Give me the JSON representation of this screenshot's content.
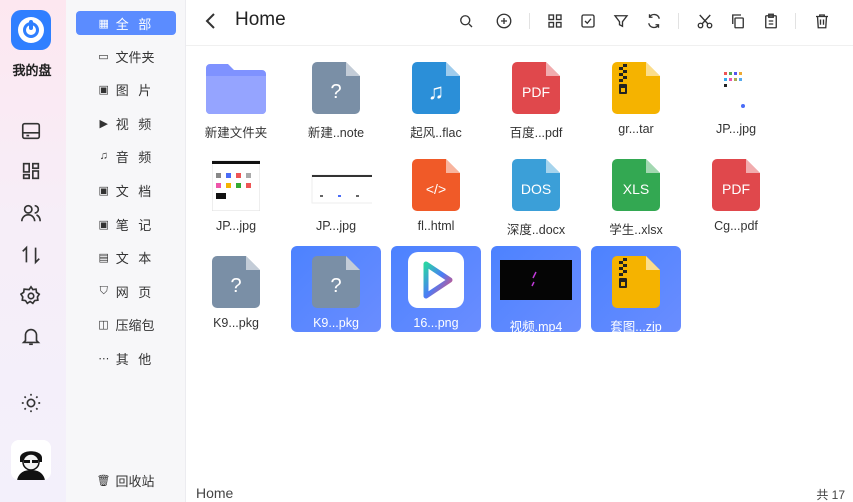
{
  "app": {
    "brand": "我的盘"
  },
  "sidebar": {
    "items": [
      {
        "label": "全 部",
        "icon": "grid-icon",
        "active": true
      },
      {
        "label": "文件夹",
        "icon": "folder-icon"
      },
      {
        "label": "图 片",
        "icon": "image-icon"
      },
      {
        "label": "视 频",
        "icon": "video-icon"
      },
      {
        "label": "音 频",
        "icon": "music-icon"
      },
      {
        "label": "文 档",
        "icon": "document-image-icon"
      },
      {
        "label": "笔 记",
        "icon": "note-icon"
      },
      {
        "label": "文 本",
        "icon": "text-file-icon"
      },
      {
        "label": "网 页",
        "icon": "html-icon"
      },
      {
        "label": "压缩包",
        "icon": "archive-icon"
      },
      {
        "label": "其 他",
        "icon": "more-icon"
      }
    ],
    "trash": {
      "label": "回收站",
      "icon": "trash-icon"
    }
  },
  "header": {
    "title": "Home"
  },
  "files": [
    {
      "name": "新建文件夹",
      "type": "folder",
      "selected": false
    },
    {
      "name": "新建..note",
      "type": "unknown",
      "color": "#7a8fa6",
      "selected": false
    },
    {
      "name": "起风..flac",
      "type": "audio",
      "color": "#2b8fd8",
      "selected": false
    },
    {
      "name": "百度...pdf",
      "type": "pdf",
      "color": "#e0484c",
      "label": "PDF",
      "selected": false
    },
    {
      "name": "gr...tar",
      "type": "archive",
      "color": "#f5b300",
      "selected": false
    },
    {
      "name": "JP...jpg",
      "type": "image-thumb",
      "selected": false
    },
    {
      "name": "JP...jpg",
      "type": "image-thumb",
      "selected": false
    },
    {
      "name": "JP...jpg",
      "type": "image-wide",
      "selected": false
    },
    {
      "name": "fl..html",
      "type": "html",
      "color": "#f05a28",
      "label": "</>",
      "selected": false
    },
    {
      "name": "深度..docx",
      "type": "doc",
      "color": "#3b9fd8",
      "label": "DOS",
      "selected": false
    },
    {
      "name": "学生..xlsx",
      "type": "xls",
      "color": "#33a852",
      "label": "XLS",
      "selected": false
    },
    {
      "name": "Cg...pdf",
      "type": "pdf",
      "color": "#e0484c",
      "label": "PDF",
      "selected": false
    },
    {
      "name": "K9...pkg",
      "type": "unknown",
      "color": "#7a8fa6",
      "selected": false
    },
    {
      "name": "K9...pkg",
      "type": "unknown",
      "color": "#7a8fa6",
      "selected": true
    },
    {
      "name": "16...png",
      "type": "play-logo",
      "selected": true
    },
    {
      "name": "视频.mp4",
      "type": "video-thumb",
      "selected": true
    },
    {
      "name": "套图...zip",
      "type": "archive",
      "color": "#f5b300",
      "selected": true
    }
  ],
  "status": {
    "path": "Home",
    "count": "共 17"
  }
}
